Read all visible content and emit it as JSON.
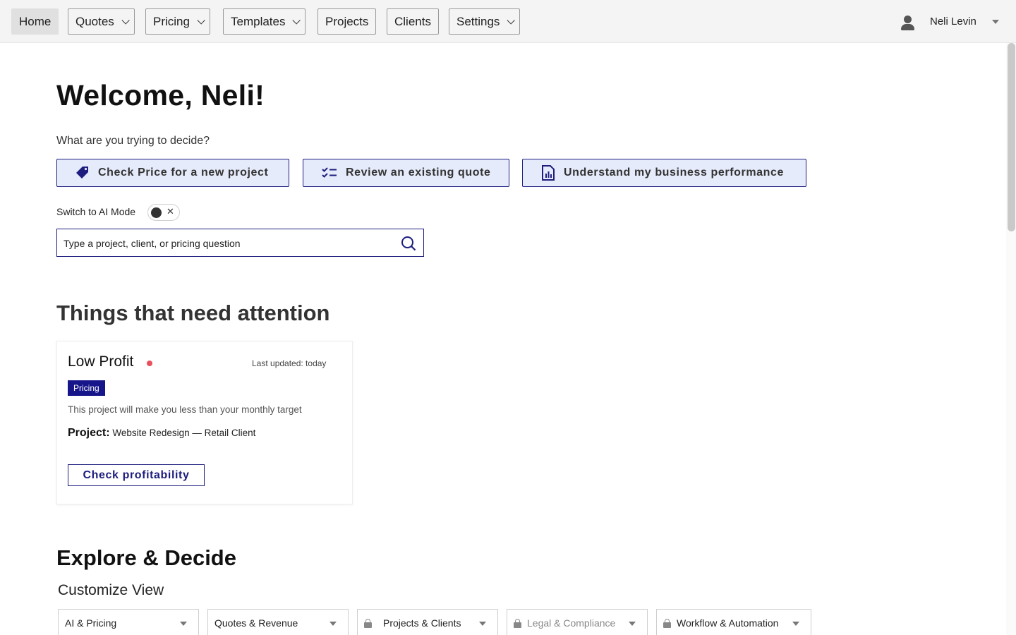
{
  "nav": {
    "items": [
      {
        "label": "Home",
        "dropdown": false,
        "active": true
      },
      {
        "label": "Quotes",
        "dropdown": true,
        "active": false
      },
      {
        "label": "Pricing",
        "dropdown": true,
        "active": false
      },
      {
        "label": "Templates",
        "dropdown": true,
        "active": false
      },
      {
        "label": "Projects",
        "dropdown": false,
        "active": false
      },
      {
        "label": "Clients",
        "dropdown": false,
        "active": false
      },
      {
        "label": "Settings",
        "dropdown": true,
        "active": false
      }
    ],
    "user_name": "Neli Levin"
  },
  "welcome": {
    "title": "Welcome, Neli!",
    "question": "What are you trying to decide?"
  },
  "actions": [
    {
      "label": "Check Price for a new project",
      "icon": "price-tag-icon"
    },
    {
      "label": "Review an existing quote",
      "icon": "checklist-icon"
    },
    {
      "label": "Understand my business performance",
      "icon": "report-chart-icon"
    }
  ],
  "ai_mode": {
    "label": "Switch to AI Mode",
    "enabled": false,
    "off_symbol": "✕"
  },
  "search": {
    "placeholder": "Type a project, client, or pricing question"
  },
  "attention": {
    "heading": "Things that need attention",
    "card": {
      "title": "Low Profit",
      "updated": "Last updated: today",
      "tag": "Pricing",
      "description": "This project will make you less than your monthly target",
      "project_label": "Project:",
      "project_value": "Website Redesign — Retail Client",
      "button": "Check profitability",
      "status_color": "#e8505b"
    }
  },
  "explore": {
    "heading": "Explore & Decide",
    "customize_label": "Customize View",
    "filters": [
      {
        "label": "AI & Pricing",
        "locked": false,
        "disabled": false
      },
      {
        "label": "Quotes & Revenue",
        "locked": false,
        "disabled": false
      },
      {
        "label": "Projects & Clients",
        "locked": true,
        "disabled": false
      },
      {
        "label": "Legal & Compliance",
        "locked": true,
        "disabled": true
      },
      {
        "label": "Workflow & Automation",
        "locked": true,
        "disabled": false
      }
    ]
  },
  "colors": {
    "accent": "#1d1d7e",
    "accent_light": "#e6ebfb",
    "tag_bg": "#16168a",
    "nav_bg": "#f4f4f4"
  }
}
